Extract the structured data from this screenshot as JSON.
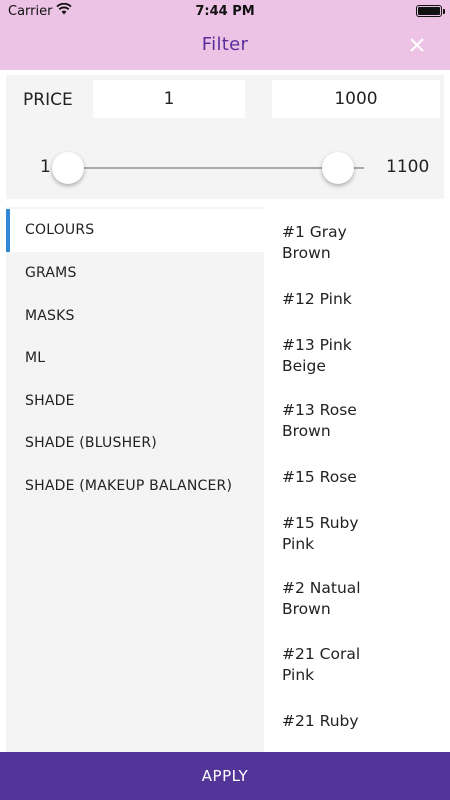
{
  "status": {
    "carrier": "Carrier",
    "time": "7:44 PM"
  },
  "header": {
    "title": "Filter",
    "close_icon": "close-icon",
    "background": "#ecc3e4",
    "title_color": "#5b2d9b"
  },
  "price": {
    "label": "PRICE",
    "min_value": "1",
    "max_value": "1000",
    "range_min_label": "1",
    "range_max_label": "1100"
  },
  "categories": [
    {
      "label": "COLOURS",
      "active": true
    },
    {
      "label": "GRAMS"
    },
    {
      "label": "MASKS"
    },
    {
      "label": "ML"
    },
    {
      "label": "SHADE"
    },
    {
      "label": "SHADE (BLUSHER)"
    },
    {
      "label": "SHADE (MAKEUP BALANCER)"
    }
  ],
  "options": [
    "#1 Gray Brown",
    "#12 Pink",
    "#13 Pink Beige",
    "#13 Rose Brown",
    "#15 Rose",
    "#15 Ruby Pink",
    "#2 Natual Brown",
    "#21 Coral Pink",
    "#21 Ruby"
  ],
  "apply": {
    "label": "APPLY",
    "background": "#53359a"
  },
  "accent_color": "#2f89d6"
}
